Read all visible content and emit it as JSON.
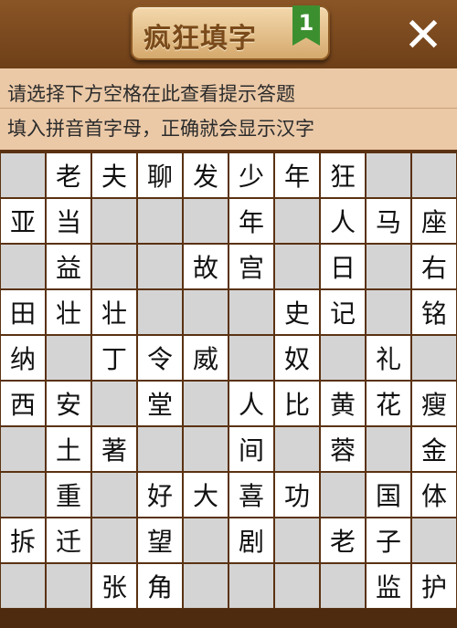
{
  "header": {
    "title": "疯狂填字",
    "level": "1",
    "close_icon": "close-icon"
  },
  "hint": {
    "line1": "请选择下方空格在此查看提示答题",
    "line2": "填入拼音首字母，正确就会显示汉字"
  },
  "grid": {
    "rows": [
      [
        "",
        "老",
        "夫",
        "聊",
        "发",
        "少",
        "年",
        "狂",
        "",
        ""
      ],
      [
        "亚",
        "当",
        "",
        "",
        "",
        "年",
        "",
        "人",
        "马",
        "座"
      ],
      [
        "",
        "益",
        "",
        "",
        "故",
        "宫",
        "",
        "日",
        "",
        "右"
      ],
      [
        "田",
        "壮",
        "壮",
        "",
        "",
        "",
        "史",
        "记",
        "",
        "铭"
      ],
      [
        "纳",
        "",
        "丁",
        "令",
        "威",
        "",
        "奴",
        "",
        "礼",
        ""
      ],
      [
        "西",
        "安",
        "",
        "堂",
        "",
        "人",
        "比",
        "黄",
        "花",
        "瘦"
      ],
      [
        "",
        "土",
        "著",
        "",
        "",
        "间",
        "",
        "蓉",
        "",
        "金"
      ],
      [
        "",
        "重",
        "",
        "好",
        "大",
        "喜",
        "功",
        "",
        "国",
        "体"
      ],
      [
        "拆",
        "迁",
        "",
        "望",
        "",
        "剧",
        "",
        "老",
        "子",
        ""
      ],
      [
        "",
        "",
        "张",
        "角",
        "",
        "",
        "",
        "",
        "监",
        "护"
      ]
    ],
    "blank_color": "#d4d4d4",
    "open_color": "#ffffff"
  }
}
